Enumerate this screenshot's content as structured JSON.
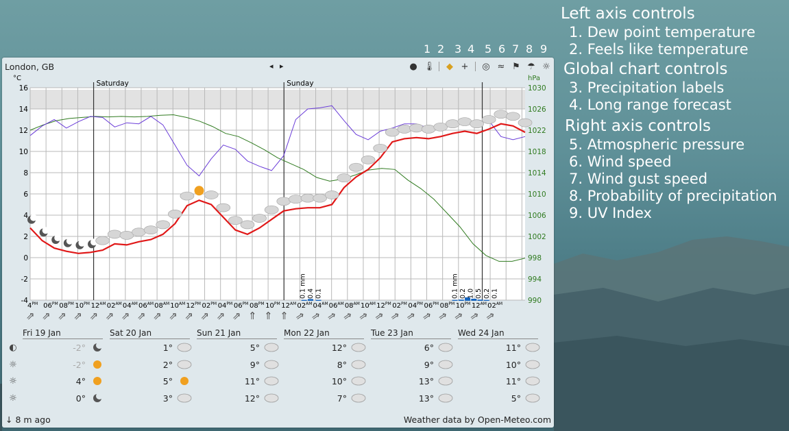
{
  "location": "London, GB",
  "nav_arrows": "◂ ▸",
  "toolbar_numbers": [
    "1",
    "2",
    "3",
    "4",
    "5",
    "6",
    "7",
    "8",
    "9"
  ],
  "toolbar_icons": [
    "dew-point-icon",
    "thermometer-icon",
    "tag-icon",
    "plus-icon",
    "pressure-icon",
    "wind-icon",
    "flag-icon",
    "umbrella-icon",
    "sun-icon"
  ],
  "legend": {
    "left_title": "Left axis controls",
    "left_items": [
      "1. Dew point temperature",
      "2. Feels like temperature"
    ],
    "global_title": "Global chart controls",
    "global_items": [
      "3. Precipitation labels",
      "4. Long range forecast"
    ],
    "right_title": "Right axis controls",
    "right_items": [
      "5. Atmospheric pressure",
      "6. Wind speed",
      "7. Wind gust speed",
      "8. Probability of precipitation",
      "9. UV Index"
    ]
  },
  "chart": {
    "left_unit": "°C",
    "right_unit": "hPa",
    "left_ticks": [
      "16",
      "14",
      "12",
      "10",
      "8",
      "6",
      "4",
      "2",
      "0",
      "-2",
      "-4"
    ],
    "right_ticks": [
      "1030",
      "1026",
      "1022",
      "1018",
      "1014",
      "1010",
      "1006",
      "1002",
      "998",
      "994",
      "990"
    ],
    "day_labels": [
      "Saturday",
      "Sunday"
    ],
    "hour_labels": [
      "4",
      "06",
      "08",
      "10",
      "12",
      "02",
      "04",
      "06",
      "08",
      "10",
      "12",
      "02",
      "04",
      "06",
      "08",
      "10",
      "12",
      "02",
      "04",
      "06",
      "08",
      "10",
      "12",
      "02",
      "04",
      "06",
      "08",
      "10",
      "12",
      "02"
    ],
    "hour_ampm": [
      "PM",
      "PM",
      "PM",
      "PM",
      "AM",
      "AM",
      "AM",
      "AM",
      "AM",
      "AM",
      "PM",
      "PM",
      "PM",
      "PM",
      "PM",
      "PM",
      "AM",
      "AM",
      "AM",
      "AM",
      "AM",
      "AM",
      "PM",
      "PM",
      "PM",
      "PM",
      "PM",
      "PM",
      "AM",
      "AM"
    ],
    "precip_labels_sun": [
      "0.1 mm",
      "0.4",
      "0.1"
    ],
    "precip_labels_mon": [
      "0.1 mm",
      "0.2",
      "1.0",
      "0.5",
      "0.2",
      "0.1"
    ]
  },
  "chart_data": {
    "type": "line",
    "xlabel": "",
    "ylabel": "°C",
    "ylim": [
      -4,
      16
    ],
    "y2label": "hPa",
    "y2lim": [
      990,
      1030
    ],
    "series": [
      {
        "values": [
          2.8,
          1.6,
          0.9,
          0.6,
          0.4,
          0.5,
          0.7,
          1.3,
          1.2,
          1.5,
          1.7,
          2.2,
          3.2,
          4.9,
          5.4,
          5.0,
          3.8,
          2.6,
          2.2,
          2.8,
          3.6,
          4.4,
          4.6,
          4.7,
          4.7,
          5.0,
          6.6,
          7.6,
          8.3,
          9.4,
          10.9,
          11.2,
          11.3,
          11.2,
          11.4,
          11.7,
          11.9,
          11.7,
          12.1,
          12.6,
          12.4,
          11.8
        ]
      },
      {
        "values": [
          11.5,
          12.4,
          13.0,
          12.2,
          12.8,
          13.3,
          13.2,
          12.3,
          12.7,
          12.6,
          13.3,
          12.5,
          10.6,
          8.7,
          7.7,
          9.3,
          10.6,
          10.2,
          9.1,
          8.6,
          8.2,
          9.6,
          13.0,
          14.0,
          14.1,
          14.3,
          12.9,
          11.6,
          11.1,
          11.9,
          12.2,
          12.6,
          12.6,
          12.2,
          12.4,
          12.7,
          12.9,
          12.7,
          12.9,
          11.4,
          11.1,
          11.4
        ]
      },
      {
        "values": [
          1022,
          1023,
          1023.8,
          1024.2,
          1024.4,
          1024.6,
          1024.5,
          1024.6,
          1024.5,
          1024.6,
          1024.8,
          1024.9,
          1024.4,
          1023.7,
          1022.7,
          1021.4,
          1020.8,
          1019.6,
          1018.3,
          1016.8,
          1015.7,
          1014.6,
          1013.1,
          1012.4,
          1012.8,
          1013.6,
          1014.5,
          1014.8,
          1014.6,
          1012.6,
          1011.0,
          1009.0,
          1006.4,
          1003.8,
          1000.6,
          998.4,
          997.3,
          997.3,
          997.9
        ]
      }
    ]
  },
  "days": [
    {
      "name": "Fri 19 Jan",
      "vals": [
        "-2°",
        "-2°",
        "4°",
        "0°"
      ]
    },
    {
      "name": "Sat 20 Jan",
      "vals": [
        "1°",
        "2°",
        "5°",
        "3°"
      ]
    },
    {
      "name": "Sun 21 Jan",
      "vals": [
        "5°",
        "9°",
        "11°",
        "12°"
      ]
    },
    {
      "name": "Mon 22 Jan",
      "vals": [
        "12°",
        "8°",
        "10°",
        "7°"
      ]
    },
    {
      "name": "Tue 23 Jan",
      "vals": [
        "6°",
        "9°",
        "13°",
        "13°"
      ]
    },
    {
      "name": "Wed 24 Jan",
      "vals": [
        "11°",
        "10°",
        "11°",
        "5°"
      ]
    }
  ],
  "row_icons": [
    "◐",
    "☼",
    "☼",
    "☼"
  ],
  "footer": {
    "updated": "↓ 8 m ago",
    "credit": "Weather data by Open-Meteo.com"
  },
  "colors": {
    "temp": "#e01818",
    "feels": "#6a3cd8",
    "pressure": "#2f7a1f",
    "accent": "#1565c0"
  }
}
